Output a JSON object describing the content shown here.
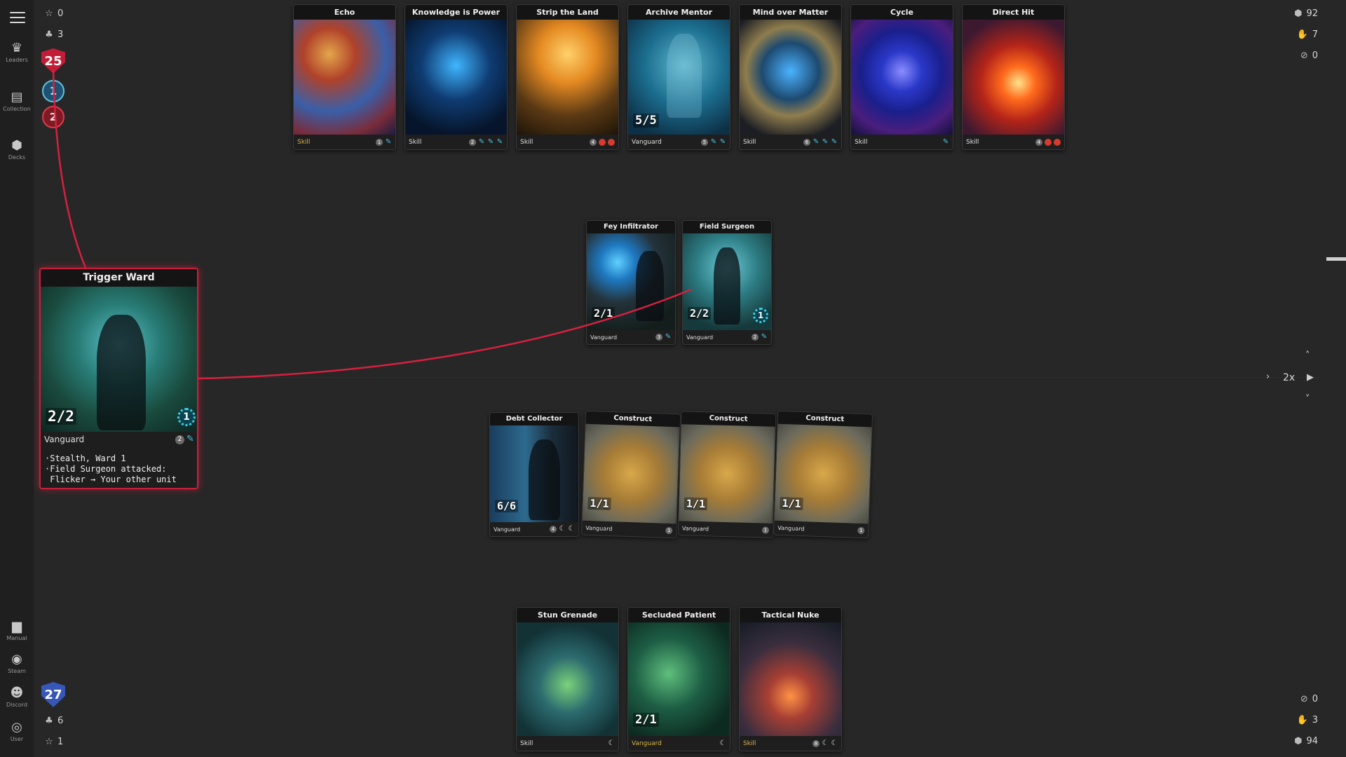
{
  "nav": {
    "leaders": "Leaders",
    "collection": "Collection",
    "decks": "Decks",
    "manual": "Manual",
    "steam": "Steam",
    "discord": "Discord",
    "user": "User"
  },
  "opponent": {
    "stars": "0",
    "units": "3",
    "health": "25",
    "token_blue": "1",
    "token_red": "2",
    "deck": "92",
    "hand": "7",
    "discard": "0"
  },
  "player": {
    "stars": "1",
    "units": "6",
    "health": "27",
    "deck": "94",
    "hand": "3",
    "discard": "0"
  },
  "speed": "2x",
  "opponent_row": [
    {
      "title": "Echo",
      "type": "Skill",
      "cost": "1",
      "pips": [
        "blue"
      ]
    },
    {
      "title": "Knowledge is Power",
      "type": "Skill",
      "cost": "2",
      "pips": [
        "blue",
        "blue",
        "blue"
      ]
    },
    {
      "title": "Strip the Land",
      "type": "Skill",
      "cost": "4",
      "pips": [
        "red",
        "red"
      ]
    },
    {
      "title": "Archive Mentor",
      "type": "Vanguard",
      "cost": "5",
      "stats": "5/5",
      "pips": [
        "blue",
        "blue"
      ]
    },
    {
      "title": "Mind over Matter",
      "type": "Skill",
      "cost": "6",
      "pips": [
        "blue",
        "blue",
        "blue"
      ]
    },
    {
      "title": "Cycle",
      "type": "Skill",
      "cost": "",
      "pips": [
        "blue"
      ]
    },
    {
      "title": "Direct Hit",
      "type": "Skill",
      "cost": "4",
      "pips": [
        "red",
        "red"
      ]
    }
  ],
  "opponent_field": [
    {
      "title": "Fey Infiltrator",
      "type": "Vanguard",
      "cost": "3",
      "stats": "2/1"
    },
    {
      "title": "Field Surgeon",
      "type": "Vanguard",
      "cost": "2",
      "stats": "2/2",
      "ward": "1"
    }
  ],
  "player_field": [
    {
      "title": "Debt Collector",
      "type": "Vanguard",
      "cost": "4",
      "stats": "6/6"
    },
    {
      "title": "Construct",
      "type": "Vanguard",
      "cost": "1",
      "stats": "1/1"
    },
    {
      "title": "Construct",
      "type": "Vanguard",
      "cost": "1",
      "stats": "1/1"
    },
    {
      "title": "Construct",
      "type": "Vanguard",
      "cost": "1",
      "stats": "1/1"
    }
  ],
  "hand": [
    {
      "title": "Stun Grenade",
      "type": "Skill"
    },
    {
      "title": "Secluded Patient",
      "type": "Vanguard",
      "stats": "2/1"
    },
    {
      "title": "Tactical Nuke",
      "type": "Skill",
      "cost": "8"
    }
  ],
  "focus_card": {
    "title": "Trigger Ward",
    "stats": "2/2",
    "ward": "1",
    "type": "Vanguard",
    "cost": "2",
    "line1": "·Stealth, Ward 1",
    "line2": "·Field Surgeon attacked:",
    "line3": " Flicker → Your other unit"
  },
  "colors": {
    "target_line": "#d8203f",
    "accent_blue": "#45c7e6",
    "health_red": "#c21d36",
    "health_blue": "#3657b8"
  }
}
